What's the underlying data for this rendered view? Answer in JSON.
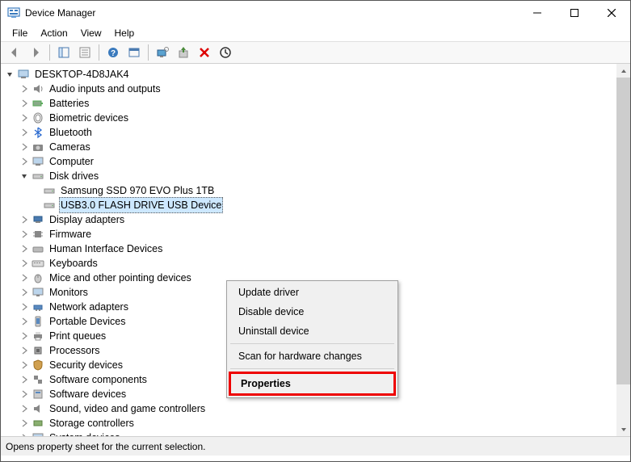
{
  "window": {
    "title": "Device Manager"
  },
  "menubar": {
    "file": "File",
    "action": "Action",
    "view": "View",
    "help": "Help"
  },
  "tree": {
    "root": "DESKTOP-4D8JAK4",
    "nodes": {
      "audio": "Audio inputs and outputs",
      "batteries": "Batteries",
      "biometric": "Biometric devices",
      "bluetooth": "Bluetooth",
      "cameras": "Cameras",
      "computer": "Computer",
      "diskdrives": "Disk drives",
      "disk1": "Samsung SSD 970 EVO Plus 1TB",
      "disk2": "USB3.0 FLASH DRIVE USB Device",
      "display": "Display adapters",
      "firmware": "Firmware",
      "hid": "Human Interface Devices",
      "keyboards": "Keyboards",
      "mice": "Mice and other pointing devices",
      "monitors": "Monitors",
      "network": "Network adapters",
      "portable": "Portable Devices",
      "printq": "Print queues",
      "processors": "Processors",
      "security": "Security devices",
      "swcomp": "Software components",
      "swdev": "Software devices",
      "sound": "Sound, video and game controllers",
      "storage": "Storage controllers",
      "system": "System devices"
    }
  },
  "contextmenu": {
    "update": "Update driver",
    "disable": "Disable device",
    "uninstall": "Uninstall device",
    "scan": "Scan for hardware changes",
    "properties": "Properties"
  },
  "statusbar": {
    "text": "Opens property sheet for the current selection."
  }
}
